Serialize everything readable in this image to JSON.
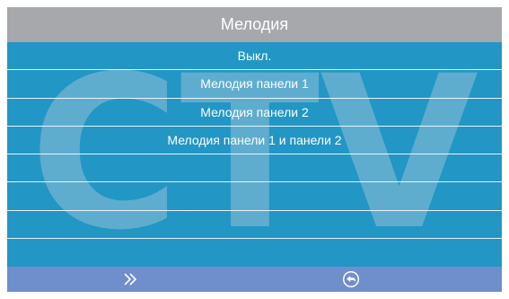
{
  "header": {
    "title": "Мелодия"
  },
  "watermark": {
    "text": "CTV"
  },
  "menu": {
    "items": [
      {
        "label": "Выкл."
      },
      {
        "label": "Мелодия панели 1"
      },
      {
        "label": "Мелодия панели 2"
      },
      {
        "label": "Мелодия панели 1 и панели 2"
      },
      {
        "label": ""
      },
      {
        "label": ""
      },
      {
        "label": ""
      },
      {
        "label": ""
      }
    ]
  },
  "footer": {
    "forward_icon": "double-chevron-right-icon",
    "back_icon": "return-arrow-icon"
  },
  "colors": {
    "menu_background": "#2296c4",
    "title_background": "#a6a8ac",
    "footer_background": "#6f8fcc",
    "text": "#ffffff"
  }
}
